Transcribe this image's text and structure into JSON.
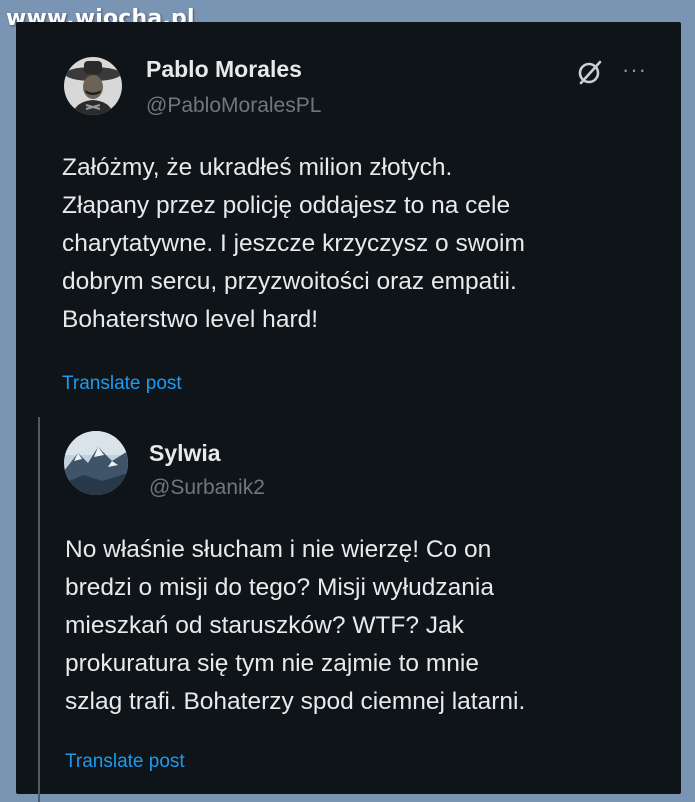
{
  "watermark": {
    "text": "www.wiocha.pl"
  },
  "tweet": {
    "author_name": "Pablo Morales",
    "author_handle": "@PabloMoralesPL",
    "text": "Załóżmy, że ukradłeś milion złotych.\nZłapany przez policję oddajesz to na cele\ncharytatywne. I jeszcze krzyczysz o swoim\ndobrym sercu, przyzwoitości oraz empatii.\nBohaterstwo level hard!",
    "translate_label": "Translate post",
    "icons": {
      "grok": "grok-icon",
      "more": "more-options-icon"
    },
    "more_label": "···"
  },
  "quoted": {
    "author_name": "Sylwia",
    "author_handle": "@Surbanik2",
    "text": "No właśnie słucham i nie wierzę! Co on\nbredzi o misji do tego? Misji wyłudzania\nmieszkań od staruszków? WTF?  Jak\nprokuratura się tym nie zajmie to mnie\nszlag trafi. Bohaterzy spod ciemnej latarni.",
    "translate_label": "Translate post"
  },
  "colors": {
    "background": "#0f1419",
    "frame": "#7a94b4",
    "text_primary": "#e7e9ea",
    "text_secondary": "#71767b",
    "accent": "#1d9bf0"
  }
}
